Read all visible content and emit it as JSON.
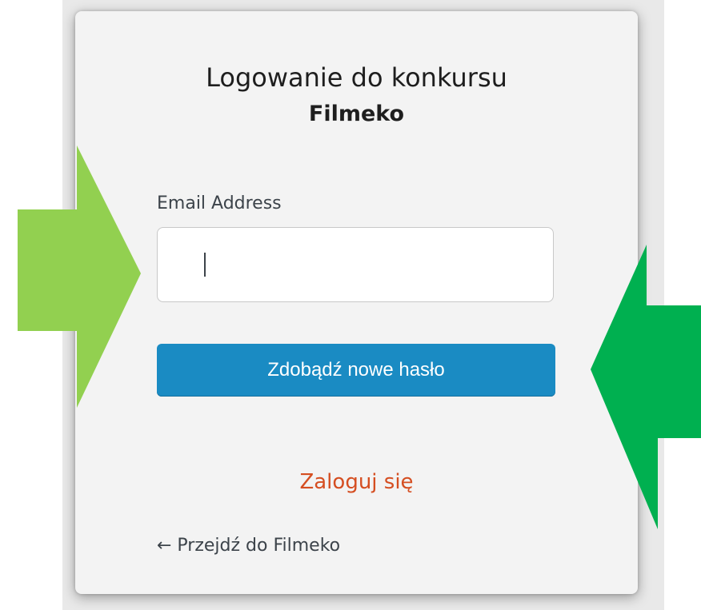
{
  "form": {
    "title_line1": "Logowanie do konkursu",
    "title_line2": "Filmeko",
    "email_label": "Email Address",
    "email_value": "",
    "submit_label": "Zdobądź nowe hasło"
  },
  "links": {
    "login": "Zaloguj się",
    "back": "← Przejdź do Filmeko"
  },
  "annotations": {
    "left_arrow": {
      "direction": "right",
      "color": "#92d050",
      "icon": "arrow-right-icon"
    },
    "right_arrow": {
      "direction": "left",
      "color": "#00b050",
      "icon": "arrow-left-icon"
    }
  },
  "colors": {
    "button": "#1a8bc3",
    "link_accent": "#d54e21",
    "card_background": "#f3f3f3"
  }
}
